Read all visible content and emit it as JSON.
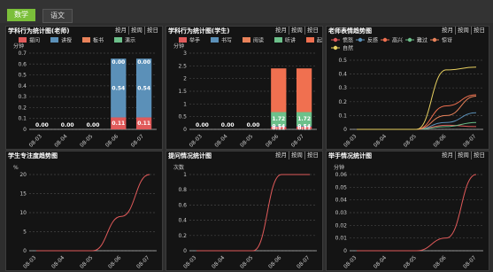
{
  "tabs": [
    {
      "label": "数学",
      "active": true
    },
    {
      "label": "语文",
      "active": false
    }
  ],
  "filters": [
    "按月",
    "按周",
    "按日"
  ],
  "panels": [
    {
      "id": "p1",
      "title": "学科行为统计图(老师)",
      "unit": "分钟",
      "chart_data": {
        "type": "bar",
        "stacked": true,
        "categories": [
          "08-03",
          "08-04",
          "08-05",
          "08-06",
          "08-07"
        ],
        "ylim": [
          0,
          0.7
        ],
        "yticks": [
          0,
          0.1,
          0.2,
          0.3,
          0.4,
          0.5,
          0.6,
          0.7
        ],
        "series": [
          {
            "name": "提问",
            "color": "#e05a5a",
            "values": [
              0,
              0,
              0,
              0.11,
              0.11
            ]
          },
          {
            "name": "讲授",
            "color": "#5b90b8",
            "values": [
              0,
              0,
              0,
              0.54,
              0.54
            ]
          },
          {
            "name": "板书",
            "color": "#e9825a",
            "values": [
              0,
              0,
              0,
              0,
              0
            ]
          },
          {
            "name": "演示",
            "color": "#6cc08a",
            "values": [
              0,
              0,
              0,
              0,
              0
            ]
          }
        ],
        "value_labels": [
          [
            "0.00"
          ],
          [
            "0.00"
          ],
          [
            "0.00"
          ],
          [
            "0.11",
            "0.54",
            "0.00"
          ],
          [
            "0.11",
            "0.54",
            "0.00"
          ]
        ]
      }
    },
    {
      "id": "p2",
      "title": "学科行为统计图(学生)",
      "unit": "分钟",
      "chart_data": {
        "type": "bar",
        "stacked": true,
        "categories": [
          "08-03",
          "08-04",
          "08-05",
          "08-06",
          "08-07"
        ],
        "ylim": [
          0,
          3
        ],
        "yticks": [
          0,
          0.5,
          1,
          1.5,
          2,
          2.5,
          3
        ],
        "series": [
          {
            "name": "举手",
            "color": "#e05a5a",
            "values": [
              0,
              0,
              0,
              0.11,
              0.11
            ]
          },
          {
            "name": "书写",
            "color": "#5b90b8",
            "values": [
              0,
              0,
              0,
              0.03,
              0.03
            ]
          },
          {
            "name": "阅读",
            "color": "#e9825a",
            "values": [
              0,
              0,
              0,
              0,
              0
            ]
          },
          {
            "name": "听讲",
            "color": "#6cc08a",
            "values": [
              0,
              0,
              0,
              0.54,
              0.54
            ]
          },
          {
            "name": "起立",
            "color": "#f07050",
            "values": [
              0,
              0,
              0,
              1.72,
              1.72
            ]
          }
        ],
        "value_labels": [
          [
            "0.00"
          ],
          [
            "0.00"
          ],
          [
            "0.00"
          ],
          [
            "0.11",
            "0.54",
            "1.72"
          ],
          [
            "0.11",
            "0.54",
            "1.72"
          ]
        ]
      }
    },
    {
      "id": "p3",
      "title": "老师表情趋势图",
      "unit": "",
      "chart_data": {
        "type": "line",
        "categories": [
          "08-03",
          "08-04",
          "08-05",
          "08-06",
          "08-07"
        ],
        "ylim": [
          0,
          0.5
        ],
        "yticks": [
          0,
          0.1,
          0.2,
          0.3,
          0.4,
          0.5
        ],
        "series": [
          {
            "name": "愤怒",
            "color": "#e05a5a",
            "values": [
              0,
              0,
              0,
              0.03,
              0.02
            ]
          },
          {
            "name": "反感",
            "color": "#5b90b8",
            "values": [
              0,
              0,
              0,
              0.05,
              0.12
            ]
          },
          {
            "name": "高兴",
            "color": "#f07050",
            "values": [
              0,
              0,
              0,
              0.17,
              0.25
            ]
          },
          {
            "name": "難过",
            "color": "#6cc08a",
            "values": [
              0,
              0,
              0,
              0.02,
              0.05
            ]
          },
          {
            "name": "惊讶",
            "color": "#e9825a",
            "values": [
              0,
              0,
              0,
              0.1,
              0.24
            ]
          },
          {
            "name": "自然",
            "color": "#e8d060",
            "values": [
              0,
              0,
              0,
              0.43,
              0.45
            ]
          }
        ]
      }
    },
    {
      "id": "p4",
      "title": "学生专注度趋势图",
      "unit": "%",
      "chart_data": {
        "type": "line",
        "categories": [
          "08-03",
          "08-04",
          "08-05",
          "08-06",
          "08-07"
        ],
        "ylim": [
          0,
          20
        ],
        "yticks": [
          0,
          5,
          10,
          15,
          20
        ],
        "series": [
          {
            "name": "专注度",
            "color": "#e05a5a",
            "values": [
              0,
              0,
              0,
              9,
              20
            ]
          }
        ]
      }
    },
    {
      "id": "p5",
      "title": "提问情况统计图",
      "unit": "次数",
      "chart_data": {
        "type": "line",
        "categories": [
          "08-03",
          "08-04",
          "08-05",
          "08-06",
          "08-07"
        ],
        "ylim": [
          0,
          1
        ],
        "yticks": [
          0,
          0.2,
          0.4,
          0.6,
          0.8,
          1
        ],
        "series": [
          {
            "name": "提问",
            "color": "#e05a5a",
            "values": [
              0,
              0,
              0,
              1,
              1
            ]
          }
        ]
      }
    },
    {
      "id": "p6",
      "title": "举手情况统计图",
      "unit": "分钟",
      "chart_data": {
        "type": "line",
        "categories": [
          "08-03",
          "08-04",
          "08-05",
          "08-06",
          "08-07"
        ],
        "ylim": [
          0,
          0.06
        ],
        "yticks": [
          0,
          0.01,
          0.02,
          0.03,
          0.04,
          0.05,
          0.06
        ],
        "series": [
          {
            "name": "举手",
            "color": "#e05a5a",
            "values": [
              0,
              0,
              0,
              0.01,
              0.06
            ]
          }
        ]
      }
    }
  ]
}
